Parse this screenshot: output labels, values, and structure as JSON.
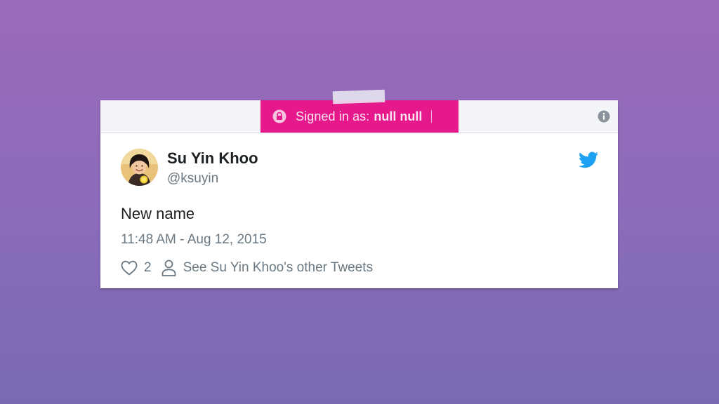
{
  "banner": {
    "label": "Signed in as:",
    "user": "null null",
    "lock_icon": "lock-icon",
    "color": "#e5198b"
  },
  "info_icon": "info-icon",
  "tweet": {
    "author_name": "Su Yin Khoo",
    "author_handle": "@ksuyin",
    "text": "New name",
    "timestamp": "11:48 AM - Aug 12, 2015",
    "like_count": "2",
    "other_tweets_link": "See Su Yin Khoo's other Tweets",
    "brand_icon": "twitter-bird-icon",
    "brand_color": "#1da1f2"
  },
  "colors": {
    "background_top": "#9a6ab9",
    "background_bottom": "#7a6ab4",
    "text_primary": "#1c2022",
    "text_secondary": "#697882"
  }
}
